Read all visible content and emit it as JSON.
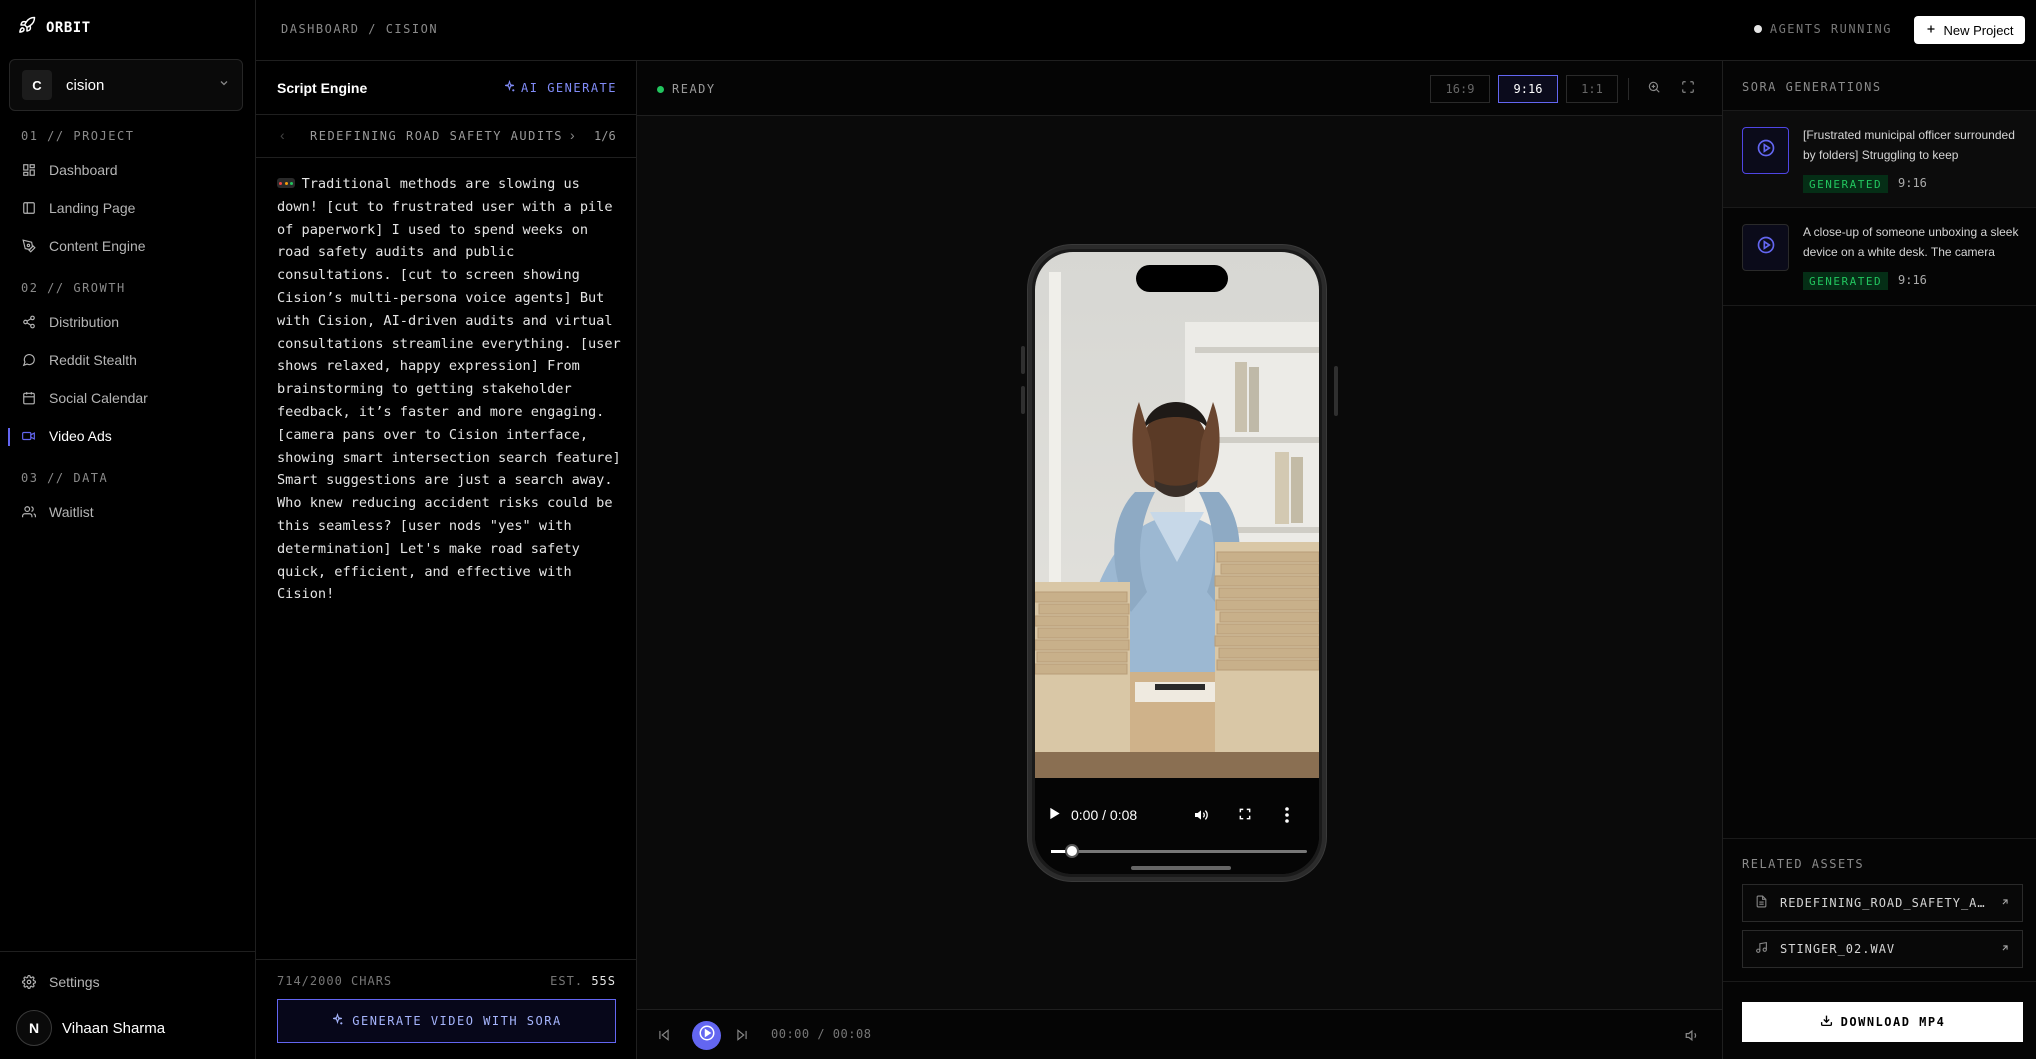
{
  "brand": {
    "name": "ORBIT"
  },
  "project_selector": {
    "initial": "C",
    "name": "cision"
  },
  "nav": {
    "sections": [
      {
        "label": "01 // PROJECT",
        "items": [
          "Dashboard",
          "Landing Page",
          "Content Engine"
        ]
      },
      {
        "label": "02 // GROWTH",
        "items": [
          "Distribution",
          "Reddit Stealth",
          "Social Calendar",
          "Video Ads"
        ]
      },
      {
        "label": "03 // DATA",
        "items": [
          "Waitlist"
        ]
      }
    ],
    "active": "Video Ads",
    "settings": "Settings"
  },
  "user": {
    "initial": "N",
    "name": "Vihaan Sharma"
  },
  "topbar": {
    "breadcrumb": "DASHBOARD / CISION",
    "status": "AGENTS RUNNING",
    "new_project": "New Project"
  },
  "script": {
    "title": "Script Engine",
    "ai_generate": "AI GENERATE",
    "pager_label": "REDEFINING ROAD SAFETY AUDITS",
    "pager_count": "1/6",
    "text": "   Traditional methods are slowing us down! [cut to frustrated user with a pile of paperwork] I used to spend weeks on road safety audits and public consultations. [cut to screen showing Cision’s multi-persona voice agents] But with Cision, AI-driven audits and virtual consultations streamline everything. [user shows relaxed, happy expression] From brainstorming to getting stakeholder feedback, it’s faster and more engaging. [camera pans over to Cision interface, showing smart intersection search feature] Smart suggestions are just a search away. Who knew reducing accident risks could be this seamless? [user nods \"yes\" with determination] Let's make road safety quick, efficient, and effective with Cision!",
    "chars": "714/2000 CHARS",
    "est_label": "EST.",
    "est_value": "55S",
    "generate_button": "GENERATE VIDEO WITH SORA"
  },
  "preview": {
    "status": "READY",
    "ratios": [
      "16:9",
      "9:16",
      "1:1"
    ],
    "selected_ratio": "9:16",
    "video_time": "0:00 / 0:08",
    "video_progress": 0.04,
    "footer_time": "00:00 / 00:08"
  },
  "generations": {
    "title": "SORA GENERATIONS",
    "items": [
      {
        "text": "[Frustrated municipal officer surrounded by folders] Struggling to keep stakeholders engaged?",
        "status": "GENERATED",
        "ratio": "9:16"
      },
      {
        "text": "A close-up of someone unboxing a sleek device on a white desk. The camera slowly pans around it.",
        "status": "GENERATED",
        "ratio": "9:16"
      }
    ]
  },
  "related": {
    "title": "RELATED ASSETS",
    "assets": [
      {
        "name": "REDEFINING_ROAD_SAFETY_AUDITS.MD",
        "icon": "document-icon"
      },
      {
        "name": "STINGER_02.WAV",
        "icon": "music-icon"
      }
    ],
    "download": "DOWNLOAD MP4"
  },
  "colors": {
    "accent": "#6366f1",
    "success": "#22c55e",
    "background": "#000000"
  }
}
